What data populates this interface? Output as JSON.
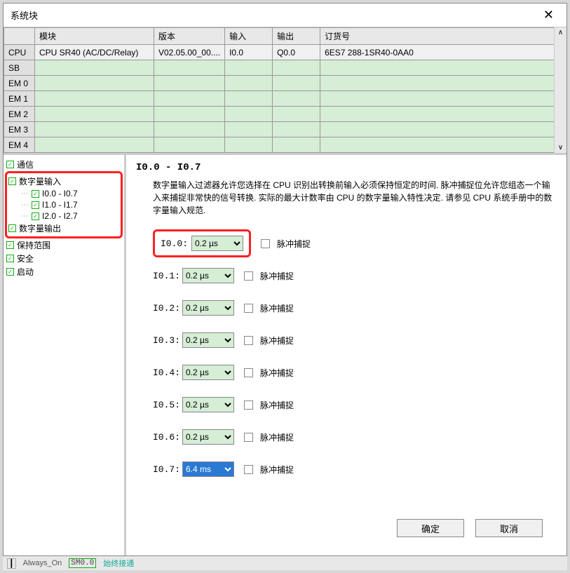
{
  "window": {
    "title": "系统块",
    "close_tooltip": "关闭"
  },
  "table": {
    "headers": [
      "",
      "模块",
      "版本",
      "输入",
      "输出",
      "订货号"
    ],
    "rows": [
      {
        "label": "CPU",
        "module": "CPU SR40 (AC/DC/Relay)",
        "version": "V02.05.00_00....",
        "input": "I0.0",
        "output": "Q0.0",
        "order": "6ES7 288-1SR40-0AA0",
        "green": false
      },
      {
        "label": "SB",
        "module": "",
        "version": "",
        "input": "",
        "output": "",
        "order": "",
        "green": true
      },
      {
        "label": "EM 0",
        "module": "",
        "version": "",
        "input": "",
        "output": "",
        "order": "",
        "green": true
      },
      {
        "label": "EM 1",
        "module": "",
        "version": "",
        "input": "",
        "output": "",
        "order": "",
        "green": true
      },
      {
        "label": "EM 2",
        "module": "",
        "version": "",
        "input": "",
        "output": "",
        "order": "",
        "green": true
      },
      {
        "label": "EM 3",
        "module": "",
        "version": "",
        "input": "",
        "output": "",
        "order": "",
        "green": true
      },
      {
        "label": "EM 4",
        "module": "",
        "version": "",
        "input": "",
        "output": "",
        "order": "",
        "green": true
      }
    ]
  },
  "tree": {
    "items": [
      {
        "label": "通信",
        "level": 0
      },
      {
        "label": "数字量输入",
        "level": 0,
        "boxed": true
      },
      {
        "label": "I0.0 - I0.7",
        "level": 1,
        "boxed": true
      },
      {
        "label": "I1.0 - I1.7",
        "level": 1,
        "boxed": true
      },
      {
        "label": "I2.0 - I2.7",
        "level": 1,
        "boxed": true
      },
      {
        "label": "数字量输出",
        "level": 0,
        "boxed_end": true
      },
      {
        "label": "保持范围",
        "level": 0
      },
      {
        "label": "安全",
        "level": 0
      },
      {
        "label": "启动",
        "level": 0
      }
    ]
  },
  "content": {
    "heading": "I0.0 - I0.7",
    "description": "数字量输入过滤器允许您选择在 CPU 识别出转换前输入必须保持恒定的时间. 脉冲捕捉位允许您组态一个输入来捕捉非常快的信号转换. 实际的最大计数率由 CPU 的数字量输入特性决定.  请参见 CPU 系统手册中的数字量输入规范.",
    "pulse_label": "脉冲捕捉",
    "filters": [
      {
        "label": "I0.0:",
        "value": "0.2 µs",
        "highlighted": true,
        "selected": false
      },
      {
        "label": "I0.1:",
        "value": "0.2 µs",
        "highlighted": false,
        "selected": false
      },
      {
        "label": "I0.2:",
        "value": "0.2 µs",
        "highlighted": false,
        "selected": false
      },
      {
        "label": "I0.3:",
        "value": "0.2 µs",
        "highlighted": false,
        "selected": false
      },
      {
        "label": "I0.4:",
        "value": "0.2 µs",
        "highlighted": false,
        "selected": false
      },
      {
        "label": "I0.5:",
        "value": "0.2 µs",
        "highlighted": false,
        "selected": false
      },
      {
        "label": "I0.6:",
        "value": "0.2 µs",
        "highlighted": false,
        "selected": false
      },
      {
        "label": "I0.7:",
        "value": "6.4 ms",
        "highlighted": false,
        "selected": true
      }
    ]
  },
  "buttons": {
    "ok": "确定",
    "cancel": "取消"
  },
  "footer": {
    "always": "Always_On",
    "sm": "SM0.0",
    "note": "始终接通"
  }
}
